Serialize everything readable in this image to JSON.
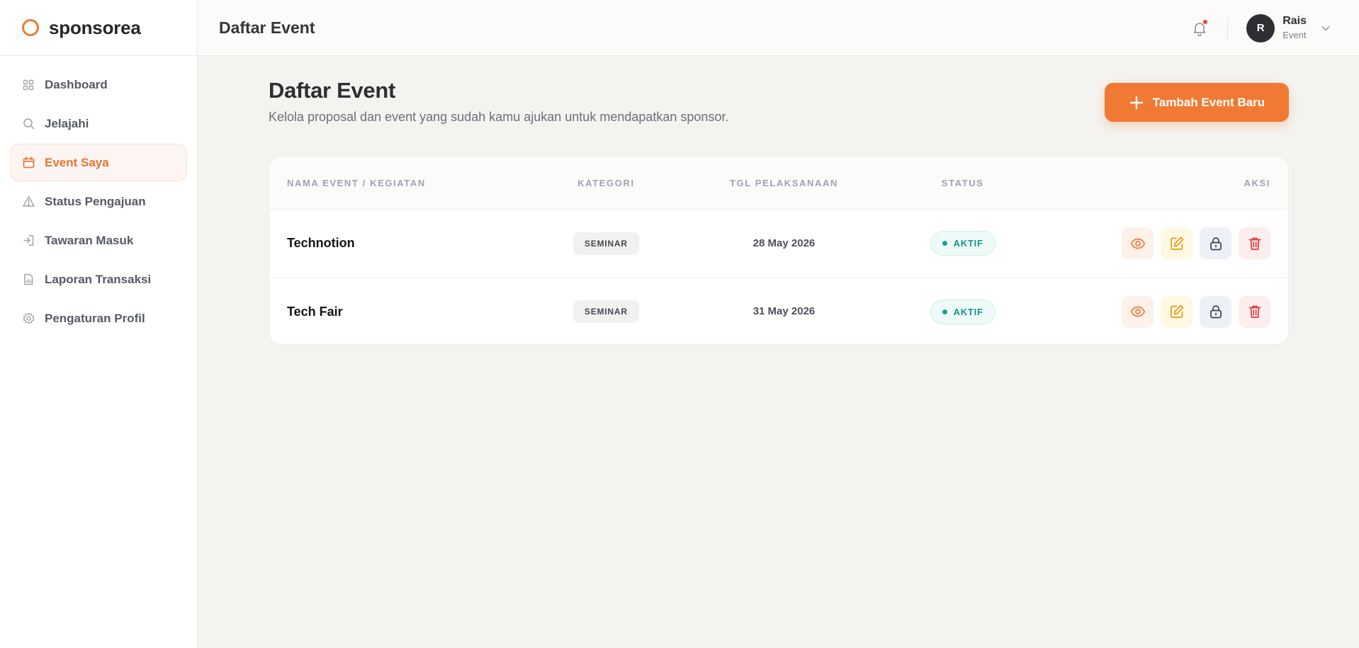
{
  "brand": {
    "name": "sponsorea"
  },
  "sidebar": {
    "items": [
      {
        "label": "Dashboard",
        "icon": "grid-icon"
      },
      {
        "label": "Jelajahi",
        "icon": "search-icon"
      },
      {
        "label": "Event Saya",
        "icon": "calendar-icon",
        "active": true
      },
      {
        "label": "Status Pengajuan",
        "icon": "triangle-alert-icon"
      },
      {
        "label": "Tawaran Masuk",
        "icon": "inbox-in-icon"
      },
      {
        "label": "Laporan Transaksi",
        "icon": "file-report-icon"
      },
      {
        "label": "Pengaturan Profil",
        "icon": "gear-icon"
      }
    ]
  },
  "topbar": {
    "title": "Daftar Event",
    "user": {
      "initial": "R",
      "name": "Rais",
      "role": "Event"
    }
  },
  "main": {
    "title": "Daftar Event",
    "subtitle": "Kelola proposal dan event yang sudah kamu ajukan untuk mendapatkan sponsor.",
    "add_button": "Tambah Event Baru",
    "table": {
      "headers": [
        "NAMA EVENT / KEGIATAN",
        "KATEGORI",
        "TGL PELAKSANAAN",
        "STATUS",
        "AKSI"
      ],
      "rows": [
        {
          "name": "Technotion",
          "category": "SEMINAR",
          "date": "28 May 2026",
          "status": "AKTIF"
        },
        {
          "name": "Tech Fair",
          "category": "SEMINAR",
          "date": "31 May 2026",
          "status": "AKTIF"
        }
      ]
    }
  },
  "colors": {
    "accent": "#f07a33",
    "status_active": "#14958a",
    "danger": "#e03a3a"
  }
}
